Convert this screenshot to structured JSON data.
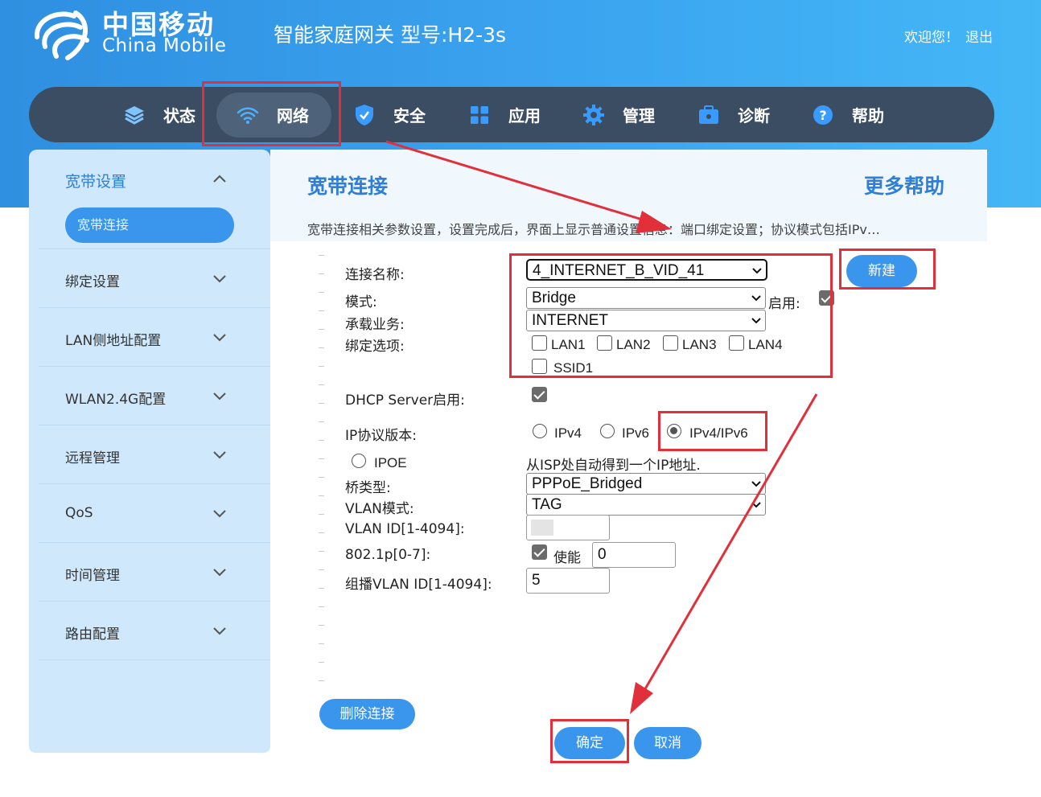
{
  "header": {
    "brand_cn": "中国移动",
    "brand_en": "China Mobile",
    "product_title": "智能家庭网关 型号:H2-3s",
    "welcome": "欢迎您！",
    "logout": "退出"
  },
  "nav": {
    "items": [
      {
        "label": "状态",
        "icon": "layers-icon"
      },
      {
        "label": "网络",
        "icon": "wifi-icon"
      },
      {
        "label": "安全",
        "icon": "shield-icon"
      },
      {
        "label": "应用",
        "icon": "grid-icon"
      },
      {
        "label": "管理",
        "icon": "gear-icon"
      },
      {
        "label": "诊断",
        "icon": "toolbox-icon"
      },
      {
        "label": "帮助",
        "icon": "help-icon"
      }
    ],
    "active": "网络"
  },
  "sidebar": {
    "groups": [
      {
        "label": "宽带设置",
        "expanded": true
      },
      {
        "label": "绑定设置"
      },
      {
        "label": "LAN侧地址配置"
      },
      {
        "label": "WLAN2.4G配置"
      },
      {
        "label": "远程管理"
      },
      {
        "label": "QoS"
      },
      {
        "label": "时间管理"
      },
      {
        "label": "路由配置"
      }
    ],
    "active_sub": "宽带连接"
  },
  "main": {
    "title": "宽带连接",
    "more_help": "更多帮助",
    "description": "宽带连接相关参数设置，设置完成后，界面上显示普通设置信息：端口绑定设置；协议模式包括IPv…"
  },
  "form": {
    "conn_name_label": "连接名称:",
    "conn_name_value": "4_INTERNET_B_VID_41",
    "new_button": "新建",
    "mode_label": "模式:",
    "mode_value": "Bridge",
    "enable_label": "启用:",
    "enable_checked": true,
    "service_label": "承载业务:",
    "service_value": "INTERNET",
    "bind_label": "绑定选项:",
    "bind_options": [
      "LAN1",
      "LAN2",
      "LAN3",
      "LAN4",
      "SSID1"
    ],
    "dhcp_label": "DHCP Server启用:",
    "dhcp_checked": true,
    "ip_version_label": "IP协议版本:",
    "ip_versions": [
      "IPv4",
      "IPv6",
      "IPv4/IPv6"
    ],
    "ip_version_selected": "IPv4/IPv6",
    "ipoe_label": "IPOE",
    "ipoe_desc": "从ISP处自动得到一个IP地址.",
    "bridge_type_label": "桥类型:",
    "bridge_type_value": "PPPoE_Bridged",
    "vlan_mode_label": "VLAN模式:",
    "vlan_mode_value": "TAG",
    "vlan_id_label": "VLAN ID[1-4094]:",
    "vlan_id_value": "",
    "p8021_label": "802.1p[0-7]:",
    "p8021_enable_label": "使能",
    "p8021_enabled": true,
    "p8021_value": "0",
    "mcast_vlan_label": "组播VLAN ID[1-4094]:",
    "mcast_vlan_value": "5",
    "delete_button": "删除连接",
    "confirm_button": "确定",
    "cancel_button": "取消"
  },
  "colors": {
    "banner": "#3aa2ef",
    "nav": "#3b4d63",
    "accent": "#3a95ec",
    "sidebar": "#cfe8fb",
    "annotation": "#e1303a"
  }
}
